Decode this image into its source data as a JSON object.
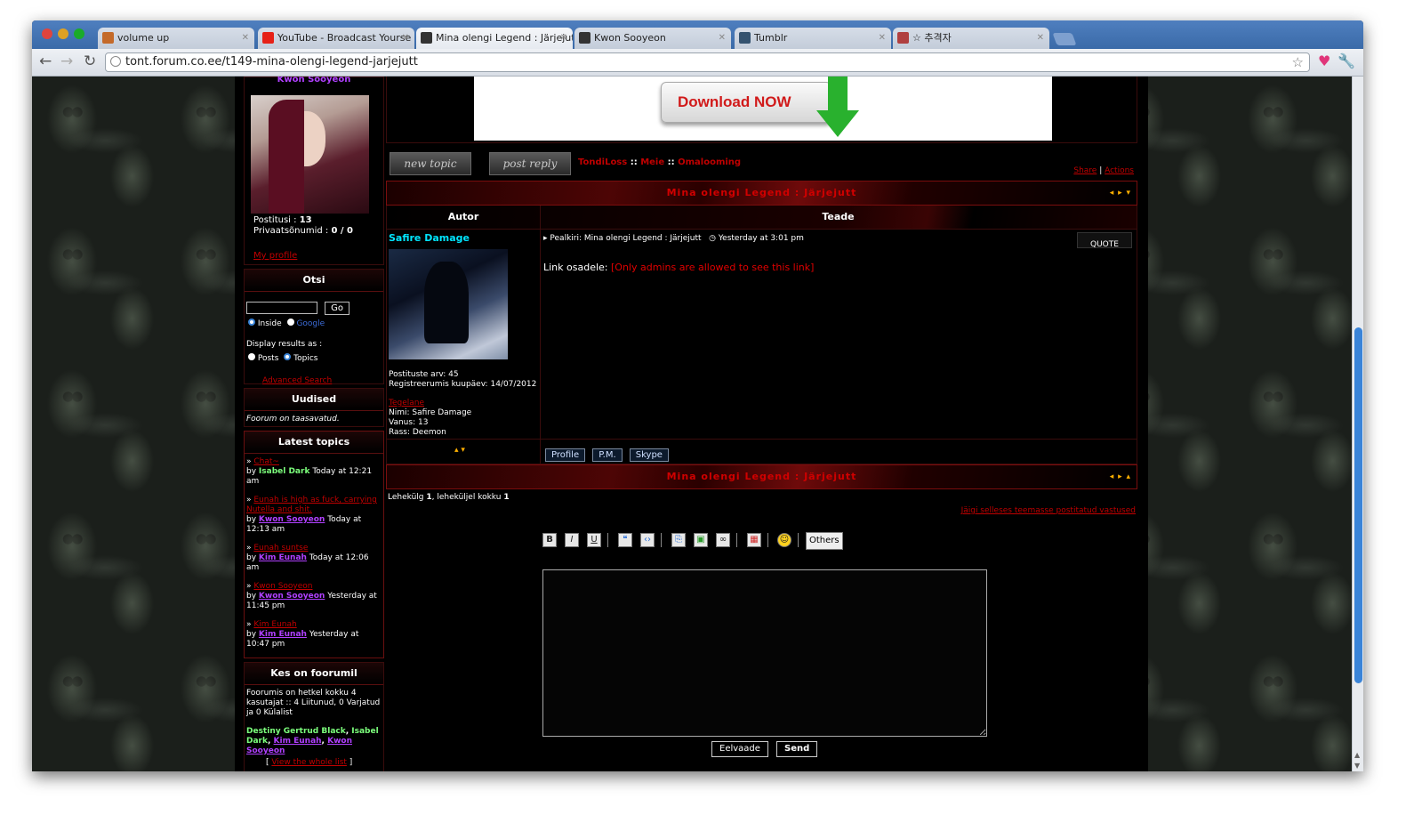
{
  "browser": {
    "tabs": [
      {
        "label": "volume up",
        "icon": "bookmark-icon",
        "icon_color": "#c46a2a"
      },
      {
        "label": "YouTube - Broadcast Yourse",
        "icon": "youtube-icon",
        "icon_color": "#e62117"
      },
      {
        "label": "Mina olengi Legend : Järjejut",
        "icon": "bird-icon",
        "icon_color": "#333333"
      },
      {
        "label": "Kwon Sooyeon",
        "icon": "bird-icon",
        "icon_color": "#333333"
      },
      {
        "label": "Tumblr",
        "icon": "tumblr-icon",
        "icon_color": "#34526f"
      },
      {
        "label": "☆ 추격자",
        "icon": "photo-icon",
        "icon_color": "#b04040"
      }
    ],
    "url": "tont.forum.co.ee/t149-mina-olengi-legend-jarjejutt"
  },
  "sidebar": {
    "username_top": "Kwon Sooyeon",
    "posts_label": "Postitusi :",
    "posts_value": "13",
    "pm_label": "Privaatsõnumid :",
    "pm_value": "0 / 0",
    "my_profile": "My profile",
    "search": {
      "title": "Otsi",
      "go": "Go",
      "inside": "Inside",
      "google": "Google",
      "display_as": "Display results as :",
      "posts": "Posts",
      "topics": "Topics",
      "advanced": "Advanced Search"
    },
    "news": {
      "title": "Uudised",
      "text": "Foorum on taasavatud."
    },
    "latest": {
      "title": "Latest topics",
      "by": "by",
      "items": [
        {
          "topic": "Chat~",
          "author": "Isabel Dark",
          "author_color": "#7cff7c",
          "time": "Today at 12:21 am"
        },
        {
          "topic": "Eunah is high as fuck, carrying Nutella and shit.",
          "author": "Kwon Sooyeon",
          "author_color": "#b040ff",
          "time": "Today at 12:13 am"
        },
        {
          "topic": "Eunah suntse",
          "author": "Kim Eunah",
          "author_color": "#b040ff",
          "time": "Today at 12:06 am"
        },
        {
          "topic": "Kwon Sooyeon",
          "author": "Kwon Sooyeon",
          "author_color": "#b040ff",
          "time": "Yesterday at 11:45 pm"
        },
        {
          "topic": "Kim Eunah",
          "author": "Kim Eunah",
          "author_color": "#b040ff",
          "time": "Yesterday at 10:47 pm"
        }
      ]
    },
    "online": {
      "title": "Kes on foorumil",
      "text": "Foorumis on hetkel kokku 4 kasutajat :: 4 Liitunud, 0 Varjatud ja 0 Külalist",
      "users": [
        {
          "name": "Destiny Gertrud Black",
          "color": "#7cff7c"
        },
        {
          "name": "Isabel Dark",
          "color": "#7cff7c"
        },
        {
          "name": "Kim Eunah",
          "color": "#b040ff"
        },
        {
          "name": "Kwon Sooyeon",
          "color": "#b040ff"
        }
      ],
      "view_all": "View the whole list"
    }
  },
  "ad": {
    "label": "Download NOW"
  },
  "main": {
    "new_topic": "new topic",
    "post_reply": "post reply",
    "breadcrumb": [
      "TondiLoss",
      "Meie",
      "Omalooming"
    ],
    "share": "Share",
    "actions": "Actions",
    "topic_title": "Mina olengi Legend : Järjejutt",
    "col_author": "Autor",
    "col_message": "Teade",
    "post": {
      "author": "Safire Damage",
      "author_color": "#00e5ff",
      "subject_label": "Pealkiri:",
      "subject": "Mina olengi Legend : Järjejutt",
      "time": "Yesterday at 3:01 pm",
      "quote": "QUOTE",
      "body_label": "Link osadele:",
      "body_link": "[Only admins are allowed to see this link]",
      "post_count_label": "Postituste arv:",
      "post_count": "45",
      "reg_label": "Registreerumis kuupäev:",
      "reg_date": "14/07/2012",
      "character_sheet": "Tegelane",
      "name_label": "Nimi:",
      "name": "Safire Damage",
      "age_label": "Vanus:",
      "age": "13",
      "race_label": "Rass:",
      "race": "Deemon",
      "buttons": [
        "Profile",
        "P.M.",
        "Skype"
      ]
    },
    "pagination": {
      "page_word": "Lehekülg",
      "page": "1",
      "of_word": "leheküljel kokku",
      "total": "1"
    },
    "unanswered": "Jäigi selleses teemasse postitatud vastused",
    "editor": {
      "others": "Others",
      "preview": "Eelvaade",
      "send": "Send"
    }
  }
}
